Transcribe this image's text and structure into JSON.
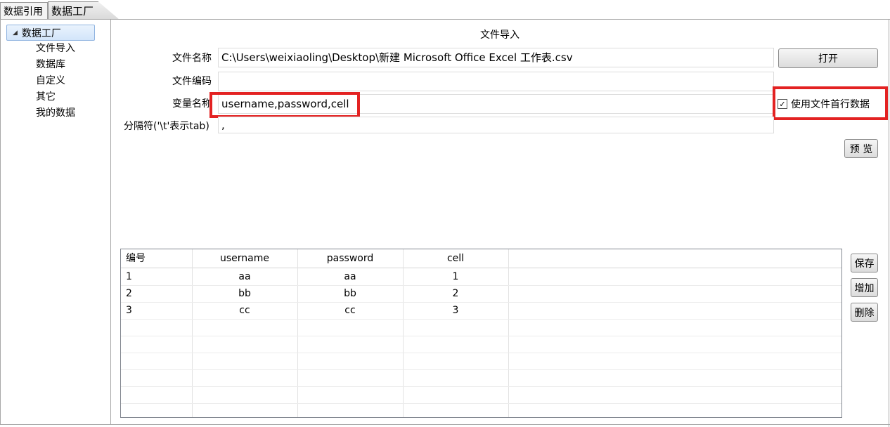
{
  "tabs": [
    {
      "label": "数据引用"
    },
    {
      "label": "数据工厂"
    }
  ],
  "sidebar": {
    "root": "数据工厂",
    "items": [
      {
        "label": "文件导入"
      },
      {
        "label": "数据库"
      },
      {
        "label": "自定义"
      },
      {
        "label": "其它"
      },
      {
        "label": "我的数据"
      }
    ]
  },
  "form": {
    "title": "文件导入",
    "file_name_label": "文件名称",
    "file_name_value": "C:\\Users\\weixiaoling\\Desktop\\新建 Microsoft Office Excel 工作表.csv",
    "open_button": "打开",
    "encoding_label": "文件编码",
    "encoding_value": "",
    "var_label": "变量名称",
    "var_value": "username,password,cell",
    "use_first_row_label": "使用文件首行数据",
    "use_first_row_checked": true,
    "separator_label": "分隔符('\\t'表示tab)",
    "separator_value": ",",
    "preview_button": "预 览"
  },
  "grid": {
    "columns": [
      "编号",
      "username",
      "password",
      "cell"
    ],
    "rows": [
      [
        "1",
        "aa",
        "aa",
        "1"
      ],
      [
        "2",
        "bb",
        "bb",
        "2"
      ],
      [
        "3",
        "cc",
        "cc",
        "3"
      ]
    ]
  },
  "actions": {
    "save": "保存",
    "add": "增加",
    "delete": "删除"
  },
  "colors": {
    "highlight": "#e32222",
    "selection": "#d2e5fa"
  }
}
